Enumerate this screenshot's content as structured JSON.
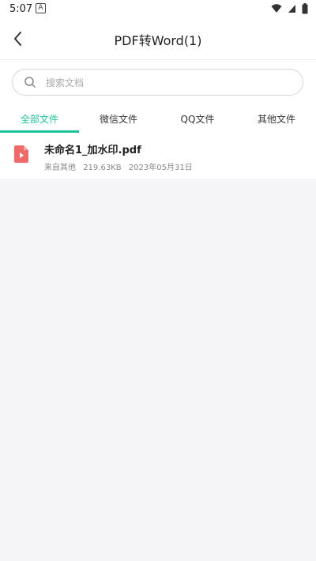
{
  "status_bar": {
    "time": "5:07",
    "app_icon_glyph": "A"
  },
  "header": {
    "title": "PDF转Word(1)"
  },
  "search": {
    "placeholder": "搜索文档",
    "value": ""
  },
  "tabs": [
    {
      "label": "全部文件",
      "active": true
    },
    {
      "label": "微信文件",
      "active": false
    },
    {
      "label": "QQ文件",
      "active": false
    },
    {
      "label": "其他文件",
      "active": false
    }
  ],
  "files": [
    {
      "name": "未命名1_加水印.pdf",
      "source": "来自其他",
      "size": "219.63KB",
      "date": "2023年05月31日",
      "icon": "pdf-file-icon"
    }
  ],
  "colors": {
    "accent": "#1ec29a",
    "pdf_icon": "#f06a6a",
    "empty_bg": "#f5f5f7"
  }
}
